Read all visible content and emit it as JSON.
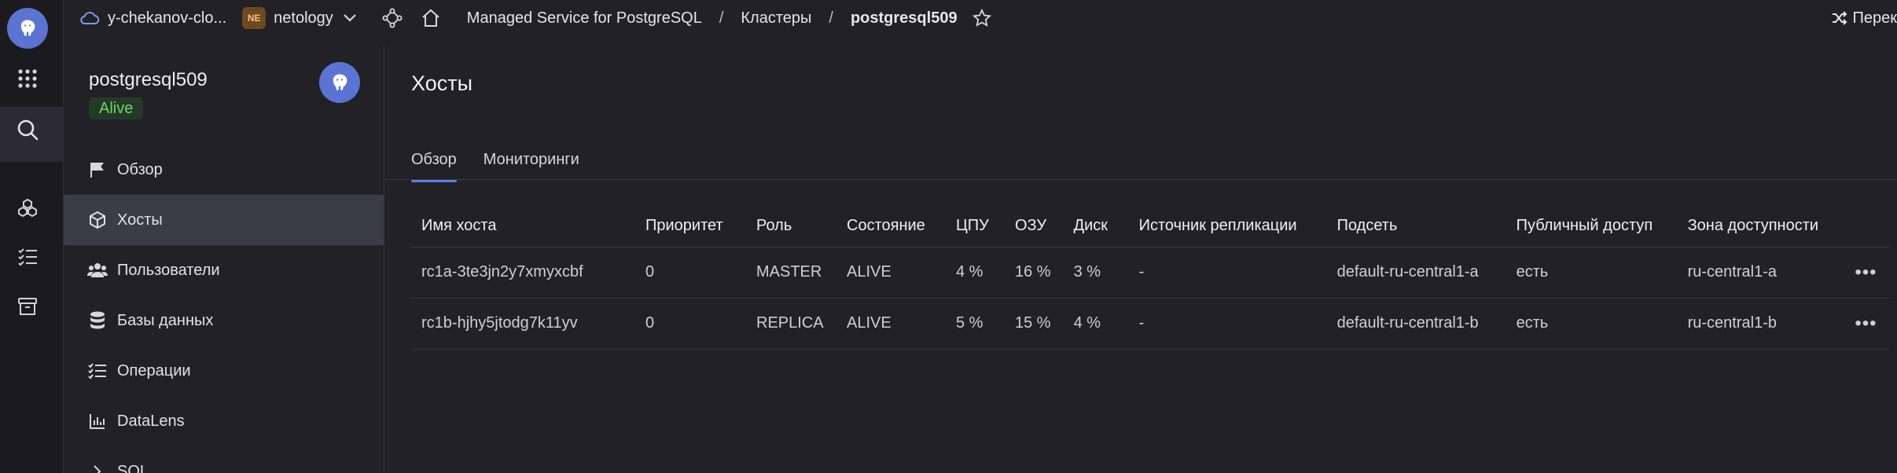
{
  "topbar": {
    "cloud": "y-chekanov-clo...",
    "folder_badge": "NE",
    "folder": "netology",
    "service": "Managed Service for PostgreSQL",
    "crumb_clusters": "Кластеры",
    "crumb_cluster": "postgresql509",
    "separator": "/",
    "switch_label": "Перек"
  },
  "cluster": {
    "name": "postgresql509",
    "status": "Alive"
  },
  "nav": {
    "items": [
      {
        "label": "Обзор",
        "icon": "flag-icon"
      },
      {
        "label": "Хосты",
        "icon": "cube-icon"
      },
      {
        "label": "Пользователи",
        "icon": "users-icon"
      },
      {
        "label": "Базы данных",
        "icon": "database-icon"
      },
      {
        "label": "Операции",
        "icon": "list-check-icon"
      },
      {
        "label": "DataLens",
        "icon": "chart-icon"
      },
      {
        "label": "SQL",
        "icon": "chevron-right-icon"
      }
    ]
  },
  "page": {
    "title": "Хосты",
    "tabs": [
      "Обзор",
      "Мониторинги"
    ]
  },
  "table": {
    "headers": [
      "Имя хоста",
      "Приоритет",
      "Роль",
      "Состояние",
      "ЦПУ",
      "ОЗУ",
      "Диск",
      "Источник репликации",
      "Подсеть",
      "Публичный доступ",
      "Зона доступности"
    ],
    "rows": [
      {
        "host": "rc1a-3te3jn2y7xmyxcbf",
        "priority": "0",
        "role": "MASTER",
        "state": "ALIVE",
        "cpu": "4 %",
        "ram": "16 %",
        "disk": "3 %",
        "source": "-",
        "subnet": "default-ru-central1-a",
        "public": "есть",
        "zone": "ru-central1-a"
      },
      {
        "host": "rc1b-hjhy5jtodg7k11yv",
        "priority": "0",
        "role": "REPLICA",
        "state": "ALIVE",
        "cpu": "5 %",
        "ram": "15 %",
        "disk": "4 %",
        "source": "-",
        "subnet": "default-ru-central1-b",
        "public": "есть",
        "zone": "ru-central1-b"
      }
    ],
    "row_menu": "•••"
  },
  "colors": {
    "accent": "#5b7fdc",
    "alive": "#6ec45a",
    "link": "#7ea2ff",
    "background": "#222125"
  }
}
